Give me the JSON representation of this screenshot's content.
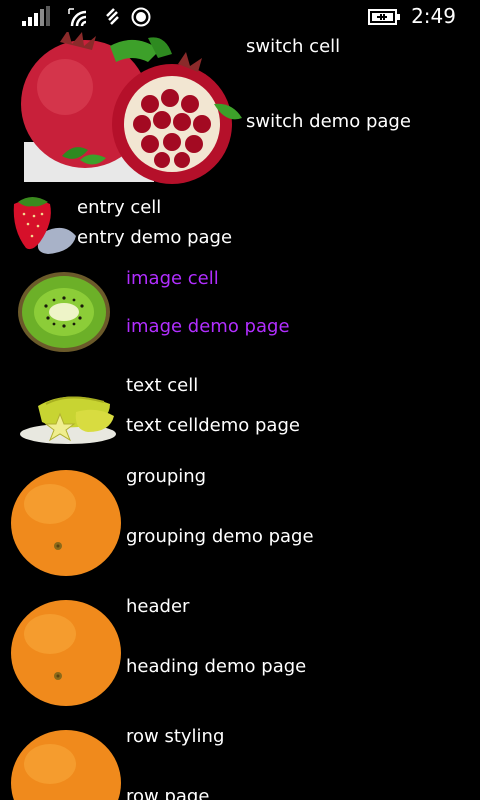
{
  "status_bar": {
    "time": "2:49",
    "icons": [
      "signal-strength-icon",
      "wifi-icon",
      "data-sync-icon",
      "location-icon",
      "battery-charging-icon"
    ]
  },
  "list": {
    "items": [
      {
        "title": "switch cell",
        "subtitle": "switch demo page",
        "image": "pomegranate-image"
      },
      {
        "title": "entry cell",
        "subtitle": "entry demo page",
        "image": "strawberry-image"
      },
      {
        "title": "image cell",
        "subtitle": "image demo page",
        "image": "kiwi-image",
        "color": "#b12eff"
      },
      {
        "title": "text cell",
        "subtitle": "text celldemo page",
        "image": "starfruit-image"
      },
      {
        "title": "grouping",
        "subtitle": "grouping demo page",
        "image": "orange-image"
      },
      {
        "title": "header",
        "subtitle": "heading demo page",
        "image": "orange-image"
      },
      {
        "title": "row styling",
        "subtitle": "row page",
        "image": "orange-image"
      }
    ]
  }
}
